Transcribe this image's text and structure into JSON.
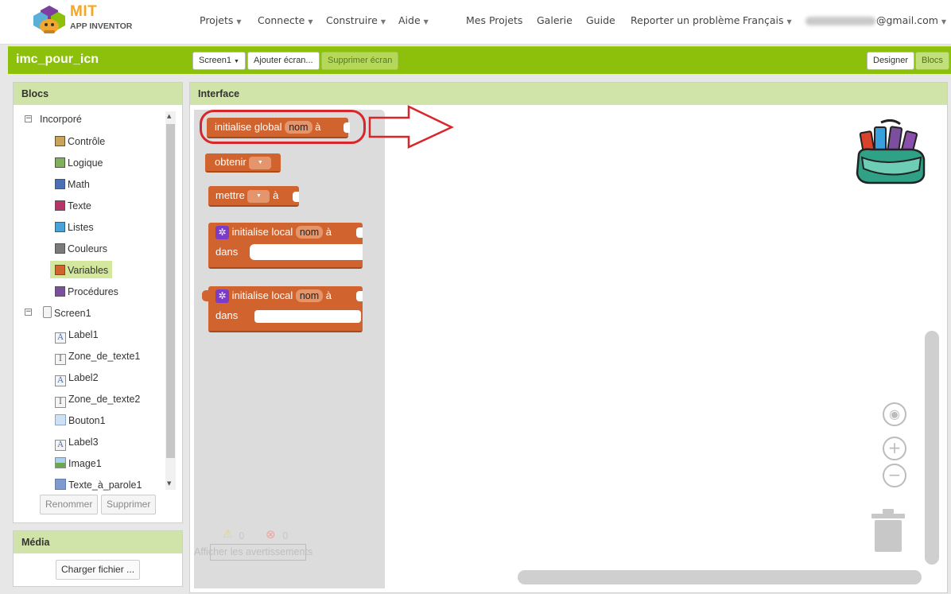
{
  "nav": {
    "logo_mit": "MIT",
    "logo_sub": "APP INVENTOR",
    "menus": [
      "Projets",
      "Connecte",
      "Construire",
      "Aide"
    ],
    "links": [
      "Mes Projets",
      "Galerie",
      "Guide",
      "Reporter un problème"
    ],
    "language": "Français",
    "email_suffix": "@gmail.com"
  },
  "project": {
    "name": "imc_pour_icn",
    "screen_select": "Screen1",
    "add_screen": "Ajouter écran...",
    "remove_screen": "Supprimer écran",
    "designer": "Designer",
    "blocks": "Blocs"
  },
  "blocs_panel": {
    "title": "Blocs",
    "builtin": "Incorporé",
    "categories": [
      {
        "label": "Contrôle",
        "color": "#c8a35a"
      },
      {
        "label": "Logique",
        "color": "#7fb05a"
      },
      {
        "label": "Math",
        "color": "#4b6fb3"
      },
      {
        "label": "Texte",
        "color": "#b8336a"
      },
      {
        "label": "Listes",
        "color": "#4aa3d8"
      },
      {
        "label": "Couleurs",
        "color": "#7a7a7a"
      },
      {
        "label": "Variables",
        "color": "#d0632e"
      },
      {
        "label": "Procédures",
        "color": "#7b4f9e"
      }
    ],
    "selected": "Variables",
    "screen": "Screen1",
    "components": [
      {
        "label": "Label1",
        "icon": "label-icon"
      },
      {
        "label": "Zone_de_texte1",
        "icon": "textbox-icon"
      },
      {
        "label": "Label2",
        "icon": "label-icon"
      },
      {
        "label": "Zone_de_texte2",
        "icon": "textbox-icon"
      },
      {
        "label": "Bouton1",
        "icon": "button-icon"
      },
      {
        "label": "Label3",
        "icon": "label-icon"
      },
      {
        "label": "Image1",
        "icon": "image-icon"
      },
      {
        "label": "Texte_à_parole1",
        "icon": "tts-icon"
      }
    ],
    "rename": "Renommer",
    "delete": "Supprimer"
  },
  "media_panel": {
    "title": "Média",
    "upload": "Charger fichier ..."
  },
  "workspace": {
    "title": "Interface",
    "blocks": {
      "init_global": "initialise global",
      "name_field": "nom",
      "to": "à",
      "get": "obtenir",
      "set": "mettre",
      "init_local": "initialise local",
      "in": "dans"
    },
    "warnings_count": "0",
    "errors_count": "0",
    "show_warnings": "Afficher les avertissements"
  },
  "colors": {
    "accent_green": "#8cc00a",
    "variables_orange": "#d0632e",
    "annotation_red": "#d9262b"
  }
}
